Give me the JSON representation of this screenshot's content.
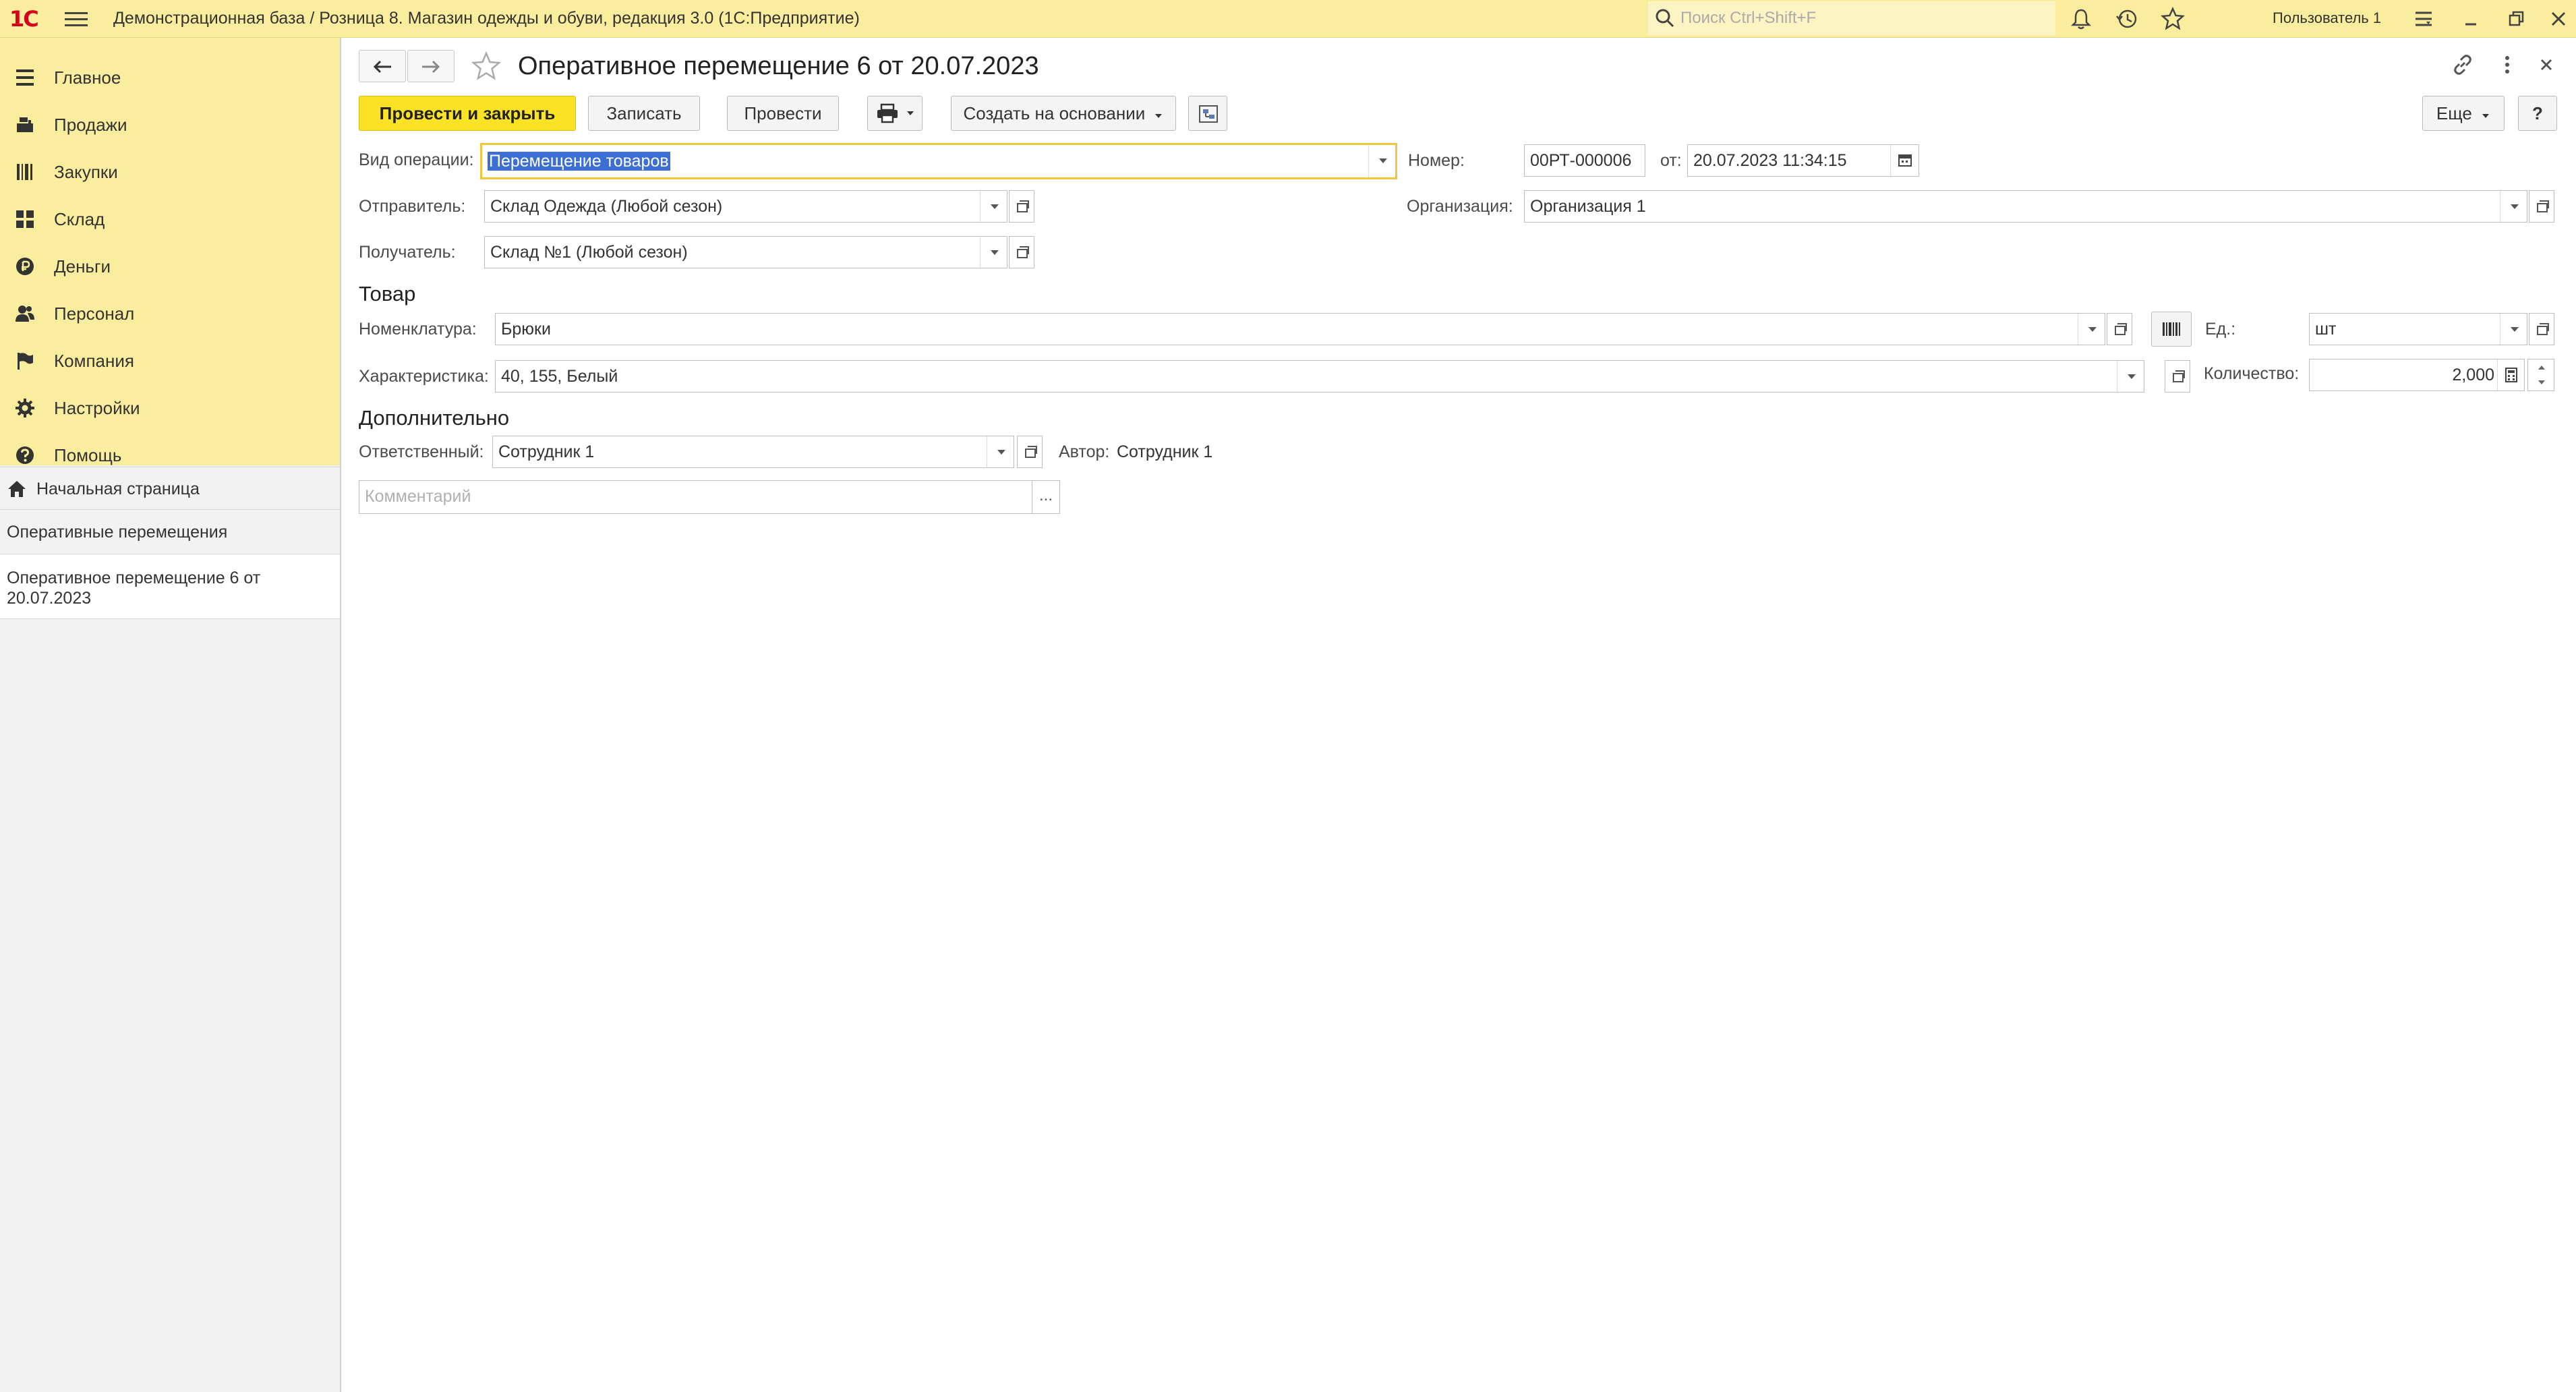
{
  "app": {
    "title": "Демонстрационная база / Розница 8. Магазин одежды и обуви, редакция 3.0  (1С:Предприятие)",
    "logo": "1С",
    "search_placeholder": "Поиск Ctrl+Shift+F",
    "user": "Пользователь 1"
  },
  "sidebar": {
    "items": [
      {
        "label": "Главное",
        "icon": "menu-lines-icon"
      },
      {
        "label": "Продажи",
        "icon": "cash-register-icon"
      },
      {
        "label": "Закупки",
        "icon": "barcode-list-icon"
      },
      {
        "label": "Склад",
        "icon": "grid-warehouse-icon"
      },
      {
        "label": "Деньги",
        "icon": "ruble-coin-icon"
      },
      {
        "label": "Персонал",
        "icon": "people-icon"
      },
      {
        "label": "Компания",
        "icon": "flag-icon"
      },
      {
        "label": "Настройки",
        "icon": "gear-icon"
      },
      {
        "label": "Помощь",
        "icon": "help-circle-icon"
      }
    ],
    "open": {
      "home": "Начальная страница",
      "list": "Оперативные перемещения",
      "doc_line1": "Оперативное перемещение 6 от",
      "doc_line2": "20.07.2023"
    }
  },
  "form": {
    "title": "Оперативное перемещение 6 от 20.07.2023",
    "toolbar": {
      "post_close": "Провести и закрыть",
      "save": "Записать",
      "post": "Провести",
      "create_based": "Создать на основании",
      "more": "Еще",
      "help": "?"
    },
    "fields": {
      "op_type_label": "Вид операции:",
      "op_type_value": "Перемещение товаров",
      "number_label": "Номер:",
      "number_value": "00РТ-000006",
      "date_label": "от:",
      "date_value": "20.07.2023 11:34:15",
      "sender_label": "Отправитель:",
      "sender_value": "Склад Одежда (Любой сезон)",
      "org_label": "Организация:",
      "org_value": "Организация 1",
      "receiver_label": "Получатель:",
      "receiver_value": "Склад №1 (Любой сезон)"
    },
    "goods": {
      "section": "Товар",
      "nomen_label": "Номенклатура:",
      "nomen_value": "Брюки",
      "unit_label": "Ед.:",
      "unit_value": "шт",
      "char_label": "Характеристика:",
      "char_value": "40, 155, Белый",
      "qty_label": "Количество:",
      "qty_value": "2,000"
    },
    "extra": {
      "section": "Дополнительно",
      "resp_label": "Ответственный:",
      "resp_value": "Сотрудник 1",
      "author_label": "Автор:",
      "author_value": "Сотрудник 1",
      "comment_placeholder": "Комментарий",
      "comment_button": "..."
    }
  },
  "colors": {
    "header_bg": "#FBED9E",
    "primary_button": "#FCE225",
    "active_border": "#F0C63A",
    "selection": "#3B6FD4"
  }
}
